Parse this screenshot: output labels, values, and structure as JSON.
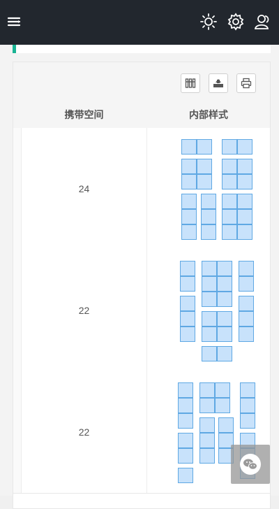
{
  "header": {
    "menu_icon": "menu-toggle-icon",
    "right_icons": [
      "brightness-icon",
      "settings-gear-icon",
      "user-profile-icon"
    ]
  },
  "colors": {
    "topbar": "#22272e",
    "accent": "#1ab394",
    "seat_fill": "#c8e2fb",
    "seat_border": "#5fa8e3"
  },
  "toolbar": {
    "buttons": [
      "columns-icon",
      "export-icon",
      "print-icon"
    ]
  },
  "table": {
    "columns": [
      "携带空间",
      "内部样式"
    ],
    "rows": [
      {
        "capacity": "24"
      },
      {
        "capacity": "22"
      },
      {
        "capacity": "22"
      }
    ]
  },
  "floating": {
    "icon": "wechat-icon"
  }
}
